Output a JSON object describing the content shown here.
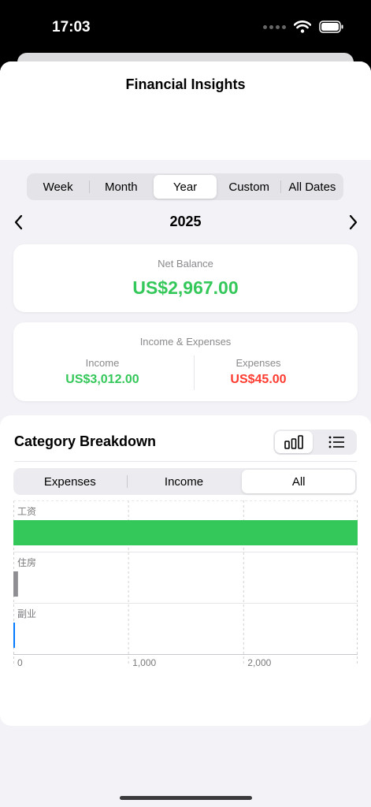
{
  "status_bar": {
    "time": "17:03",
    "signal_icon": "cellular-dots-icon",
    "wifi_icon": "wifi-icon",
    "battery_icon": "battery-icon"
  },
  "header": {
    "title": "Financial Insights"
  },
  "period_tabs": [
    {
      "label": "Week",
      "active": false
    },
    {
      "label": "Month",
      "active": false
    },
    {
      "label": "Year",
      "active": true
    },
    {
      "label": "Custom",
      "active": false
    },
    {
      "label": "All Dates",
      "active": false
    }
  ],
  "year_nav": {
    "label": "2025",
    "prev_icon": "chevron-left-icon",
    "next_icon": "chevron-right-icon"
  },
  "net_balance": {
    "caption": "Net Balance",
    "amount": "US$2,967.00"
  },
  "income_expenses": {
    "caption": "Income & Expenses",
    "income_label": "Income",
    "income_value": "US$3,012.00",
    "expenses_label": "Expenses",
    "expenses_value": "US$45.00"
  },
  "category_breakdown": {
    "title": "Category Breakdown",
    "view_toggle": [
      {
        "icon": "bar-chart-icon",
        "active": true
      },
      {
        "icon": "list-icon",
        "active": false
      }
    ],
    "type_tabs": [
      {
        "label": "Expenses",
        "active": false
      },
      {
        "label": "Income",
        "active": false
      },
      {
        "label": "All",
        "active": true
      }
    ]
  },
  "chart_data": {
    "type": "bar",
    "orientation": "horizontal",
    "categories": [
      "工资",
      "住房",
      "副业"
    ],
    "values": [
      3000,
      40,
      12
    ],
    "colors": [
      "#34c759",
      "#8e8e93",
      "#007aff"
    ],
    "xlim": [
      0,
      2990
    ],
    "xticks": [
      0,
      1000,
      2000
    ],
    "xtick_labels": [
      "0",
      "1,000",
      "2,000"
    ],
    "grid": true
  },
  "colors": {
    "income": "#34c759",
    "expense": "#ff3b30"
  }
}
